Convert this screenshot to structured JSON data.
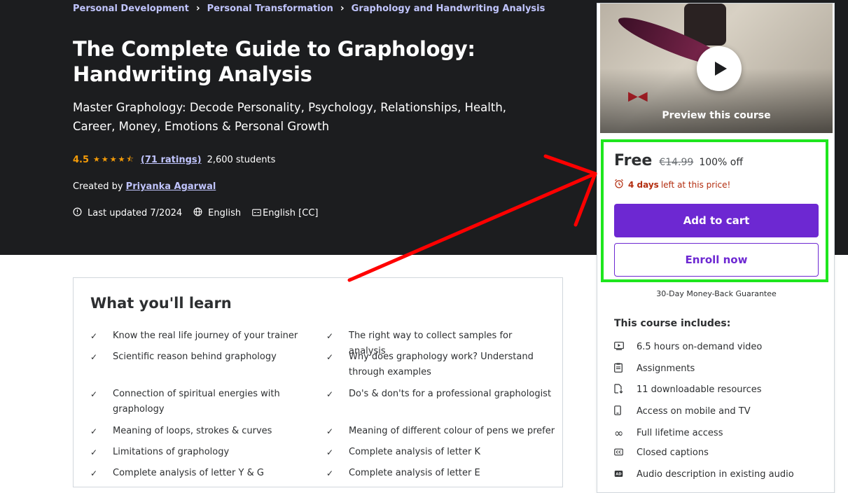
{
  "breadcrumb": [
    "Personal Development",
    "Personal Transformation",
    "Graphology and Handwriting Analysis"
  ],
  "course": {
    "title": "The Complete Guide to Graphology: Handwriting Analysis",
    "subtitle": "Master Graphology: Decode Personality, Psychology, Relationships, Health, Career, Money, Emotions & Personal Growth",
    "rating": "4.5",
    "rating_stars": 4.5,
    "ratings_link": "(71 ratings)",
    "students": "2,600 students",
    "created_by_label": "Created by",
    "instructor": "Priyanka Agarwal",
    "last_updated": "Last updated 7/2024",
    "language": "English",
    "captions": "English [CC]"
  },
  "learn": {
    "heading": "What you'll learn",
    "left": [
      "Know the real life journey of your trainer",
      "Scientific reason behind graphology",
      "Connection of spiritual energies with graphology",
      "Meaning of loops, strokes & curves",
      "Limitations of graphology",
      "Complete analysis of letter Y & G"
    ],
    "right": [
      "The right way to collect samples for analysis",
      "Why does graphology work? Understand through examples",
      "Do's & don'ts for a professional graphologist",
      "Meaning of different colour of pens we prefer",
      "Complete analysis of letter K",
      "Complete analysis of letter E"
    ]
  },
  "sidebar": {
    "preview_label": "Preview this course",
    "price_free": "Free",
    "price_old": "€14.99",
    "price_off": "100% off",
    "timer_days": "4 days",
    "timer_rest": "left at this price!",
    "add_to_cart": "Add to cart",
    "enroll_now": "Enroll now",
    "guarantee": "30-Day Money-Back Guarantee",
    "includes_title": "This course includes:",
    "includes": [
      {
        "icon": "video-icon",
        "label": "6.5 hours on-demand video"
      },
      {
        "icon": "assignment-icon",
        "label": "Assignments"
      },
      {
        "icon": "download-file-icon",
        "label": "11 downloadable resources"
      },
      {
        "icon": "mobile-icon",
        "label": "Access on mobile and TV"
      },
      {
        "icon": "infinity-icon",
        "label": "Full lifetime access"
      },
      {
        "icon": "captions-icon",
        "label": "Closed captions"
      },
      {
        "icon": "audio-description-icon",
        "label": "Audio description in existing audio"
      }
    ]
  },
  "colors": {
    "hero_bg": "#1c1d1f",
    "link": "#c0c4fc",
    "star": "#f69c08",
    "primary": "#6d28d2",
    "timer": "#b32d0f",
    "annotation_box": "#1ee61e",
    "annotation_arrow": "#ff0000"
  }
}
